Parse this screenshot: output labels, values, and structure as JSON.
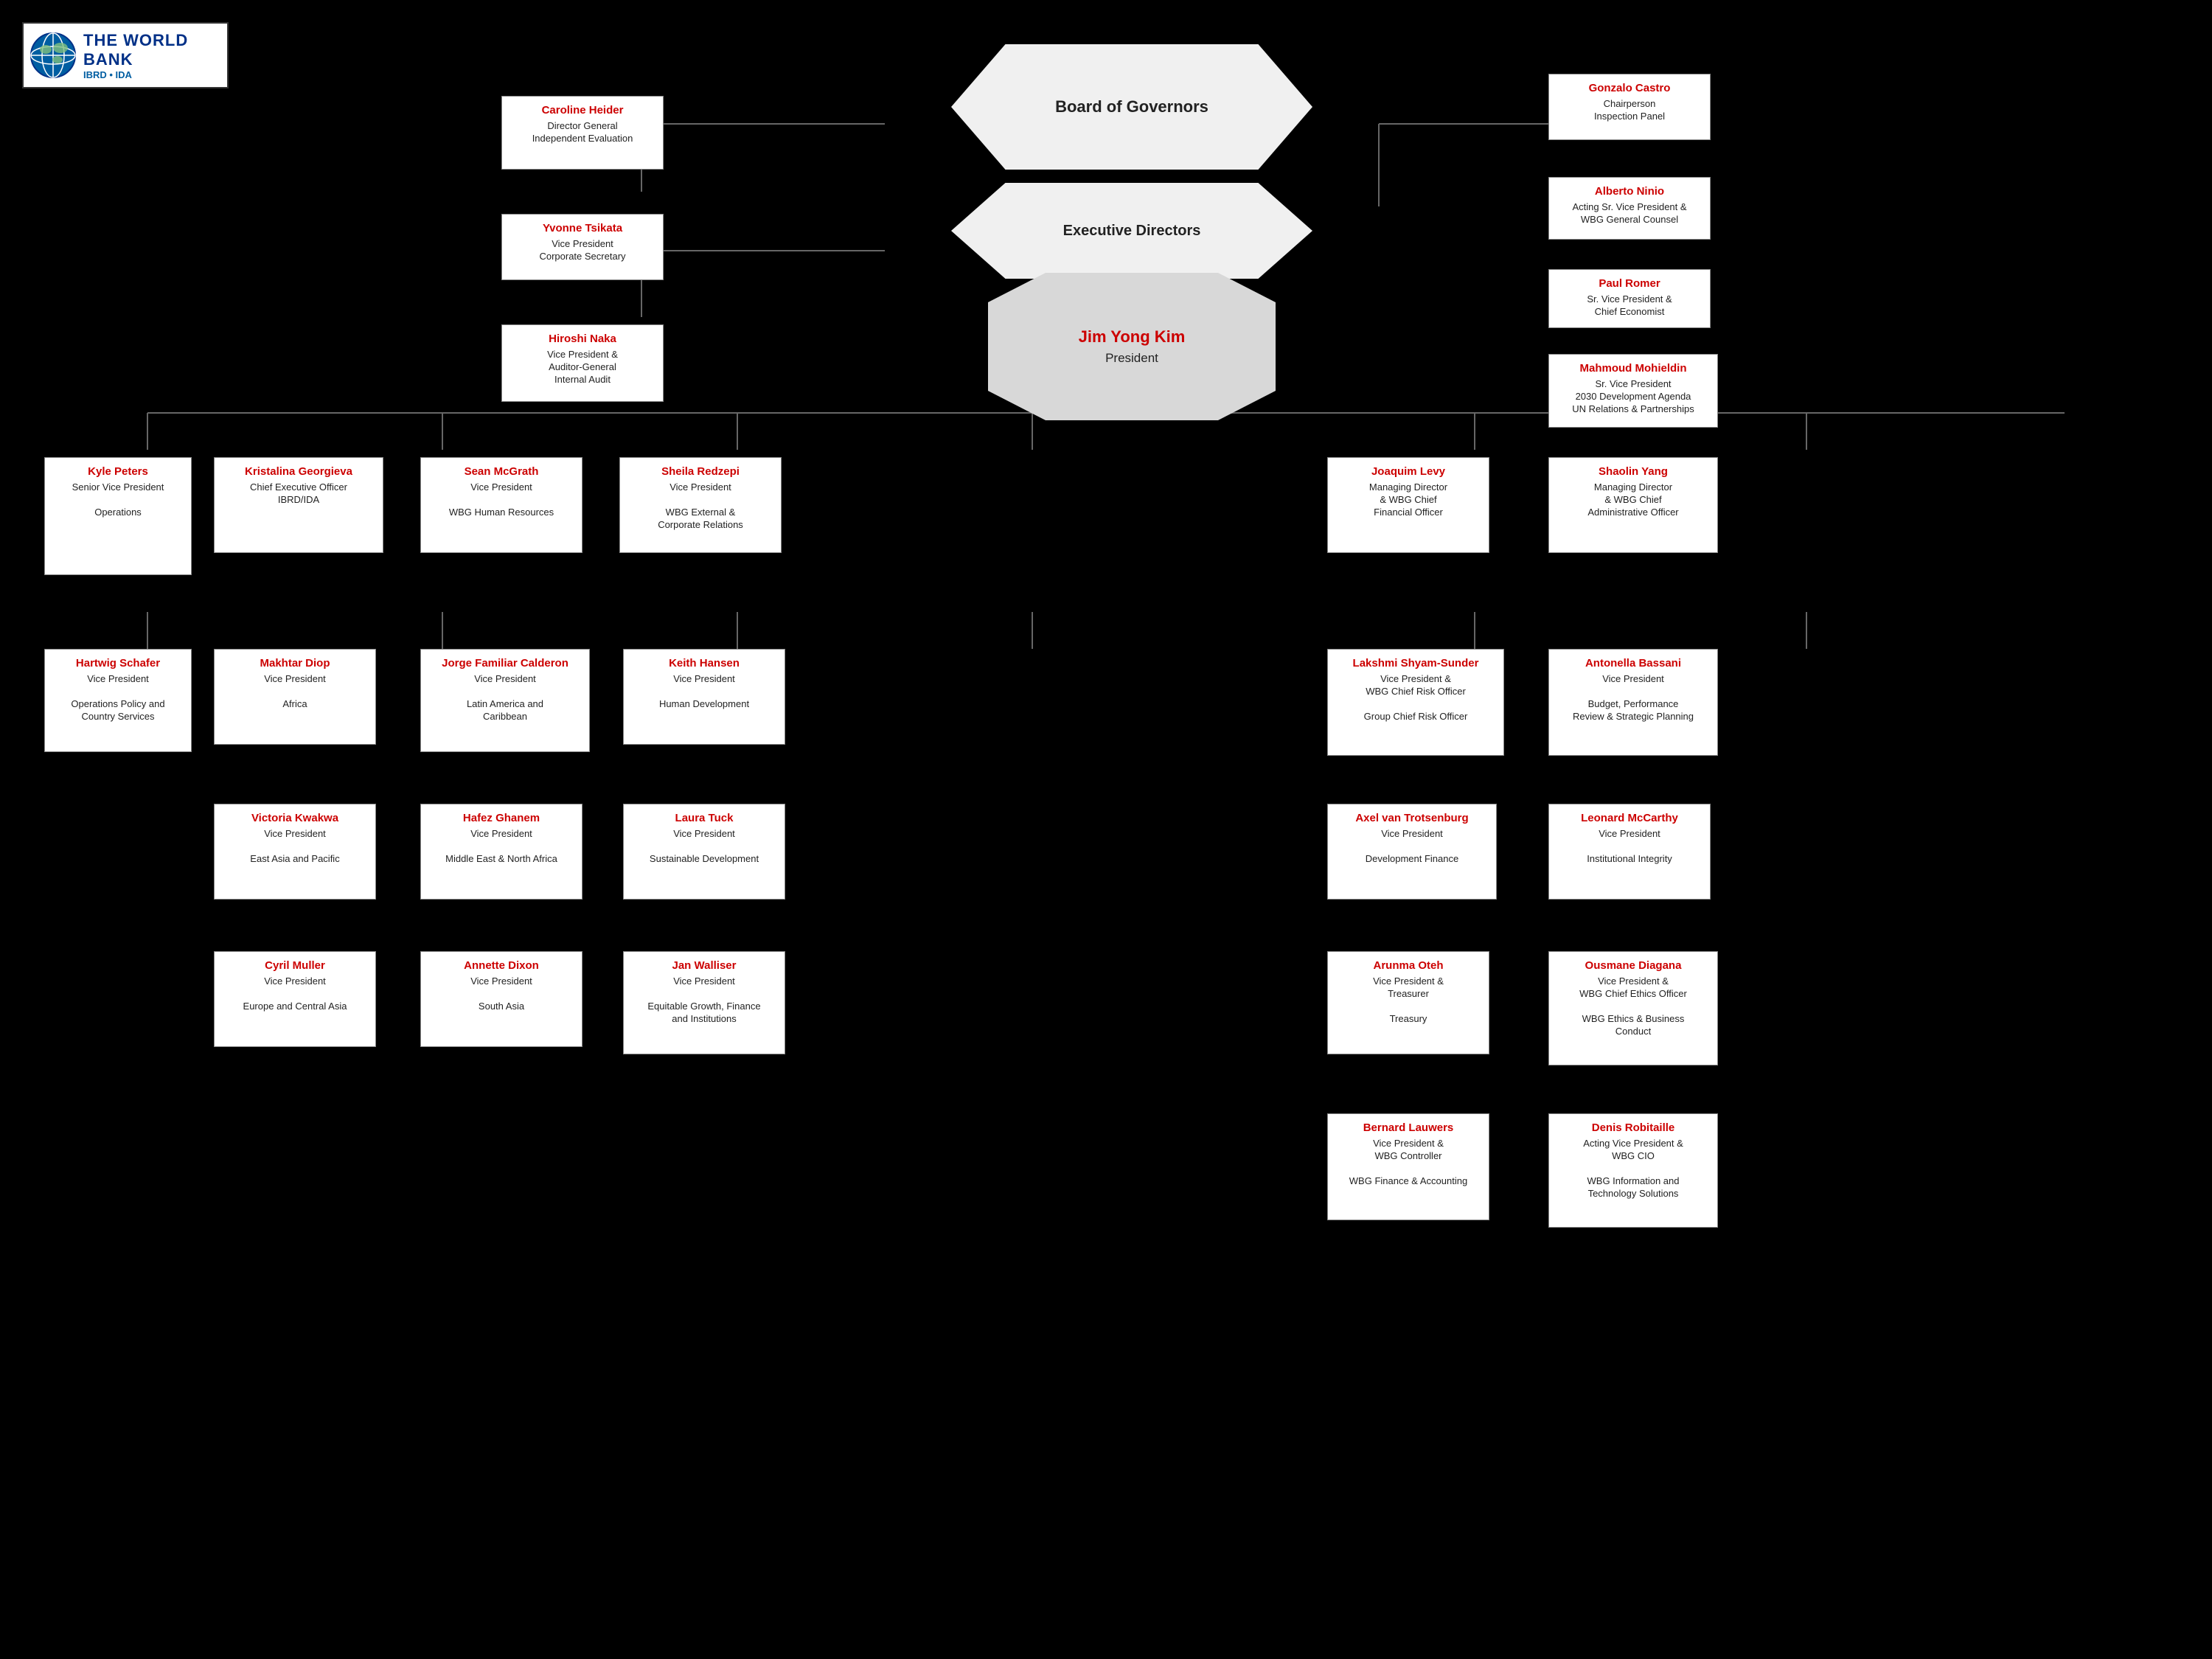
{
  "logo": {
    "title": "THE WORLD BANK",
    "sub": "IBRD • IDA"
  },
  "board_of_governors": {
    "label": "Board of Governors"
  },
  "executive_directors": {
    "label": "Executive Directors"
  },
  "president": {
    "name": "Jim Yong Kim",
    "title": "President"
  },
  "left_boxes": [
    {
      "name": "Caroline Heider",
      "title": "Director General\nIndependent Evaluation"
    },
    {
      "name": "Yvonne Tsikata",
      "title": "Vice President\nCorporate Secretary"
    },
    {
      "name": "Hiroshi Naka",
      "title": "Vice President &\nAuditor-General\nInternal Audit"
    }
  ],
  "right_top_boxes": [
    {
      "name": "Gonzalo Castro",
      "title": "Chairperson\nInspection Panel"
    },
    {
      "name": "Alberto Ninio",
      "title": "Acting Sr. Vice President &\nWBG General Counsel"
    },
    {
      "name": "Paul Romer",
      "title": "Sr. Vice President &\nChief Economist"
    },
    {
      "name": "Mahmoud Mohieldin",
      "title": "Sr. Vice President\n2030 Development Agenda\nUN Relations & Partnerships"
    }
  ],
  "mid_row1": [
    {
      "name": "Kyle Peters",
      "title": "Senior Vice President\n\nOperations"
    },
    {
      "name": "Kristalina Georgieva",
      "title": "Chief Executive Officer\nIBRD/IDA"
    },
    {
      "name": "Sean McGrath",
      "title": "Vice President\n\nWBG Human Resources"
    },
    {
      "name": "Sheila Redzepi",
      "title": "Vice President\n\nWBG External &\nCorporate Relations"
    }
  ],
  "mid_row1_right": [
    {
      "name": "Joaquim Levy",
      "title": "Managing Director\n& WBG Chief\nFinancial Officer"
    },
    {
      "name": "Shaolin Yang",
      "title": "Managing Director\n& WBG Chief\nAdministrative Officer"
    }
  ],
  "mid_row2": [
    {
      "name": "Hartwig Schafer",
      "title": "Vice President\n\nOperations Policy and\nCountry Services"
    },
    {
      "name": "Makhtar Diop",
      "title": "Vice President\n\nAfrica"
    },
    {
      "name": "Jorge Familiar Calderon",
      "title": "Vice President\n\nLatin America and\nCaribbean"
    },
    {
      "name": "Keith Hansen",
      "title": "Vice President\n\nHuman Development"
    }
  ],
  "mid_row2_right": [
    {
      "name": "Lakshmi Shyam-Sunder",
      "title": "Vice President &\nWBG Chief Risk Officer\n\nGroup Chief Risk Officer"
    },
    {
      "name": "Antonella Bassani",
      "title": "Vice President\n\nBudget, Performance\nReview & Strategic Planning"
    }
  ],
  "mid_row3": [
    {
      "name": "Victoria Kwakwa",
      "title": "Vice President\n\nEast Asia and Pacific"
    },
    {
      "name": "Hafez Ghanem",
      "title": "Vice President\n\nMiddle East & North Africa"
    },
    {
      "name": "Laura Tuck",
      "title": "Vice President\n\nSustainable Development"
    }
  ],
  "mid_row3_right": [
    {
      "name": "Axel van Trotsenburg",
      "title": "Vice President\n\nDevelopment Finance"
    },
    {
      "name": "Leonard McCarthy",
      "title": "Vice President\n\nInstitutional Integrity"
    }
  ],
  "mid_row4": [
    {
      "name": "Cyril Muller",
      "title": "Vice President\n\nEurope and Central Asia"
    },
    {
      "name": "Annette Dixon",
      "title": "Vice President\n\nSouth Asia"
    },
    {
      "name": "Jan Walliser",
      "title": "Vice President\n\nEquitable Growth, Finance\nand Institutions"
    }
  ],
  "mid_row4_right": [
    {
      "name": "Arunma Oteh",
      "title": "Vice President &\nTreasurer\n\nTreasury"
    },
    {
      "name": "Ousmane Diagana",
      "title": "Vice President  &\nWBG Chief Ethics Officer\n\nWBG Ethics & Business\nConduct"
    }
  ],
  "mid_row5_right": [
    {
      "name": "Bernard Lauwers",
      "title": "Vice President &\nWBG Controller\n\nWBG Finance & Accounting"
    },
    {
      "name": "Denis Robitaille",
      "title": "Acting Vice President &\nWBG CIO\n\nWBG Information and\nTechnology Solutions"
    }
  ]
}
